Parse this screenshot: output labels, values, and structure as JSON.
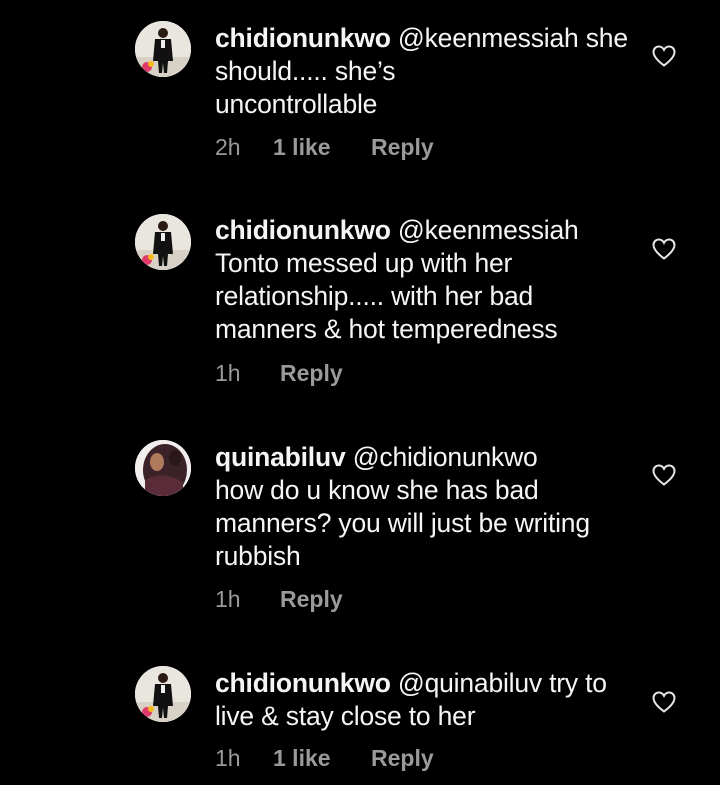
{
  "comments": [
    {
      "username": "chidionunkwo",
      "mention": "@keenmessiah",
      "text_lines": [
        "she should..... she’s",
        "uncontrollable"
      ],
      "first_line_rest": " she should..... she’s",
      "time": "2h",
      "likes": "1 like",
      "reply": "Reply"
    },
    {
      "username": "chidionunkwo",
      "mention": "@keenmessiah",
      "time": "1h",
      "likes": "",
      "reply": "Reply"
    },
    {
      "username": "quinabiluv",
      "mention": "@chidionunkwo",
      "time": "1h",
      "likes": "",
      "reply": "Reply"
    },
    {
      "username": "chidionunkwo",
      "mention": "@quinabiluv",
      "time": "1h",
      "likes": "1 like",
      "reply": "Reply"
    }
  ],
  "texts": {
    "c1_line2": "uncontrollable",
    "c1_line1_tail": " she should..... she’s",
    "c2_line2": "Tonto messed up with her",
    "c2_line3": "relationship..... with her bad",
    "c2_line4": "manners & hot temperedness",
    "c3_line2": "how do u know she has bad",
    "c3_line3": "manners? you will just be writing",
    "c3_line4": "rubbish",
    "c4_line1_tail": " try to",
    "c4_line2": "live & stay close to her"
  },
  "icons": {
    "like": "heart-outline-icon",
    "avatar": "profile-avatar"
  },
  "colors": {
    "background": "#000000",
    "text": "#f5f5f5",
    "meta": "#9a9a9a"
  }
}
